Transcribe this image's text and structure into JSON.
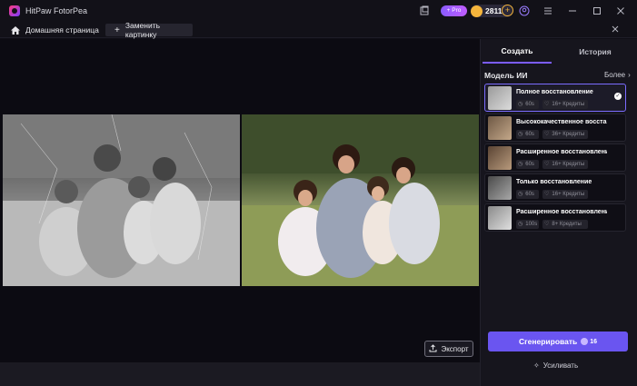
{
  "app": {
    "title": "HitPaw FotorPea",
    "pro_label": "+ Pro",
    "coins": "2811",
    "coin_plus": "+"
  },
  "tabs": {
    "home_label": "Домашняя страница",
    "replace_label": "Заменить картинку",
    "replace_plus": "+"
  },
  "canvas": {
    "export_label": "Экспорт"
  },
  "panel": {
    "tab_create": "Создать",
    "tab_history": "История",
    "model_header": "Модель ИИ",
    "more_label": "Более",
    "models": [
      {
        "name": "Полное восстановление",
        "time": "60s",
        "credits": "16+ Кредиты",
        "selected": true
      },
      {
        "name": "Высококачественное восстан...",
        "time": "60s",
        "credits": "36+ Кредиты",
        "selected": false
      },
      {
        "name": "Расширенное восстановление",
        "time": "60s",
        "credits": "16+ Кредиты",
        "selected": false
      },
      {
        "name": "Только восстановление",
        "time": "60s",
        "credits": "16+ Кредиты",
        "selected": false
      },
      {
        "name": "Расширенное восстановление...",
        "time": "100s",
        "credits": "8+ Кредиты",
        "selected": false
      }
    ],
    "generate_label": "Сгенерировать",
    "generate_cost": "16",
    "enhance_label": "Усиливать"
  },
  "colors": {
    "accent": "#6a55f0",
    "selected_border": "#7b6cff",
    "coin": "#f5b53c"
  }
}
